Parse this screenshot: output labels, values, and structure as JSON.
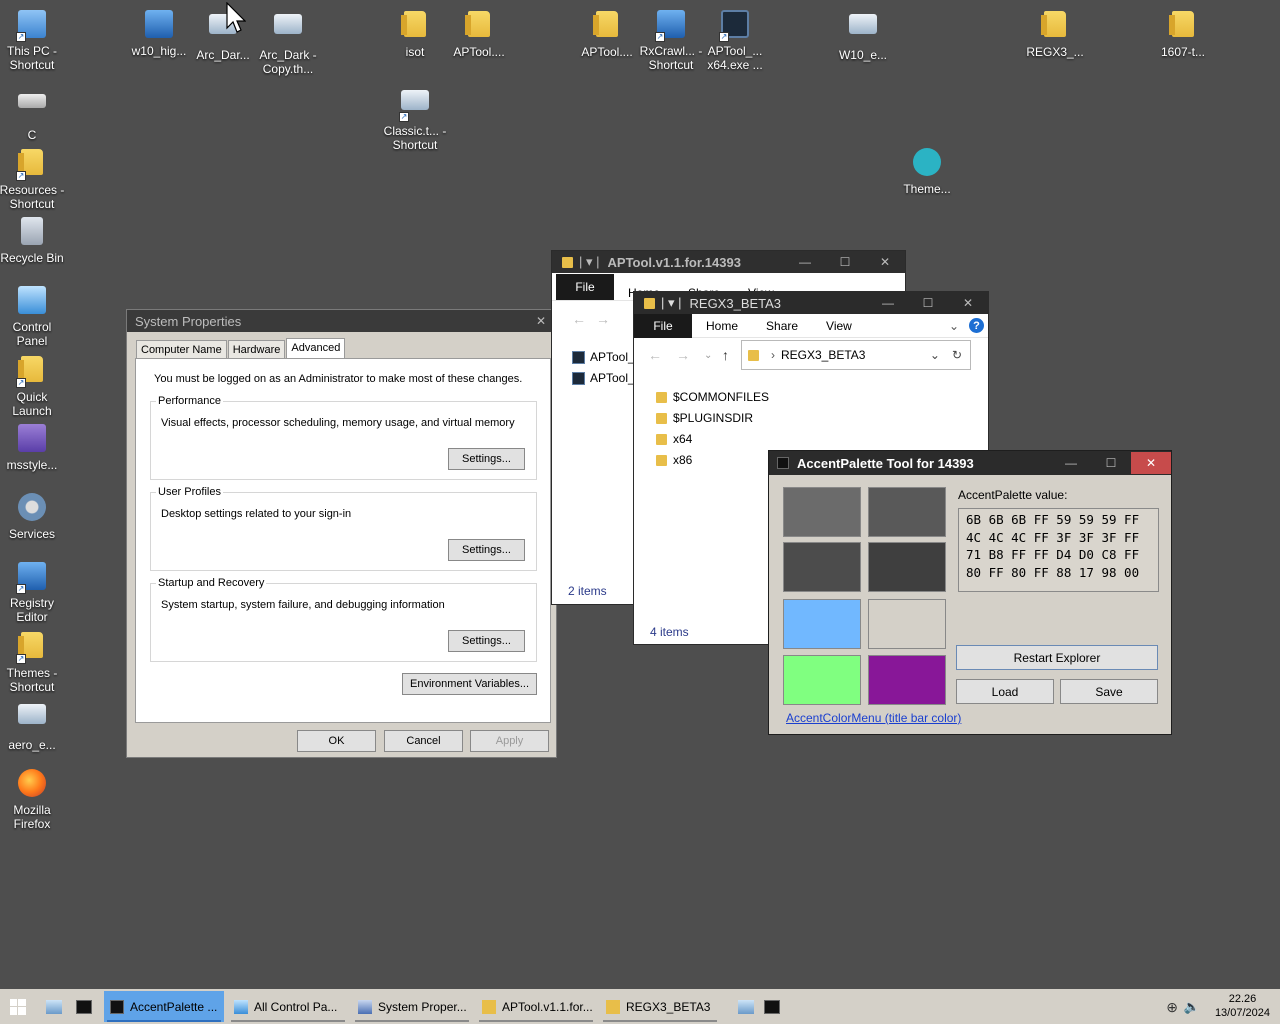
{
  "desktop": {
    "icons": [
      {
        "label": "This PC - Shortcut"
      },
      {
        "label": "C"
      },
      {
        "label": "Resources - Shortcut"
      },
      {
        "label": "Recycle Bin"
      },
      {
        "label": "Control Panel"
      },
      {
        "label": "Quick Launch"
      },
      {
        "label": "msstyle..."
      },
      {
        "label": "Services"
      },
      {
        "label": "Registry Editor"
      },
      {
        "label": "Themes - Shortcut"
      },
      {
        "label": "aero_e..."
      },
      {
        "label": "Mozilla Firefox"
      },
      {
        "label": "w10_hig..."
      },
      {
        "label": "Arc_Dar..."
      },
      {
        "label": "Arc_Dark - Copy.th..."
      },
      {
        "label": "isot"
      },
      {
        "label": "APTool...."
      },
      {
        "label": "Classic.t... - Shortcut"
      },
      {
        "label": "APTool...."
      },
      {
        "label": "RxCrawl... - Shortcut"
      },
      {
        "label": "APTool_... x64.exe ..."
      },
      {
        "label": "W10_e..."
      },
      {
        "label": "Theme..."
      },
      {
        "label": "REGX3_..."
      },
      {
        "label": "1607-t..."
      }
    ]
  },
  "sysprops": {
    "title": "System Properties",
    "tabs": [
      "Computer Name",
      "Hardware",
      "Advanced"
    ],
    "note": "You must be logged on as an Administrator to make most of these changes.",
    "groups": [
      {
        "legend": "Performance",
        "desc": "Visual effects, processor scheduling, memory usage, and virtual memory",
        "button": "Settings..."
      },
      {
        "legend": "User Profiles",
        "desc": "Desktop settings related to your sign-in",
        "button": "Settings..."
      },
      {
        "legend": "Startup and Recovery",
        "desc": "System startup, system failure, and debugging information",
        "button": "Settings..."
      }
    ],
    "env_button": "Environment Variables...",
    "ok": "OK",
    "cancel": "Cancel",
    "apply": "Apply"
  },
  "aptool_win": {
    "title": "APTool.v1.1.for.14393",
    "ribbon": [
      "File",
      "Home",
      "Share",
      "View"
    ],
    "items": [
      "APTool_",
      "APTool_"
    ],
    "status": "2 items"
  },
  "regx_win": {
    "title": "REGX3_BETA3",
    "ribbon": [
      "File",
      "Home",
      "Share",
      "View"
    ],
    "address": "REGX3_BETA3",
    "items": [
      "$COMMONFILES",
      "$PLUGINSDIR",
      "x64",
      "x86"
    ],
    "status": "4 items"
  },
  "accent": {
    "title": "AccentPalette Tool for 14393",
    "value_label": "AccentPalette value:",
    "hex_lines": [
      "6B 6B 6B FF 59 59 59 FF",
      "4C 4C 4C FF 3F 3F 3F FF",
      "71 B8 FF FF D4 D0 C8 FF",
      "80 FF 80 FF 88 17 98 00"
    ],
    "swatches": [
      "#6b6b6b",
      "#595959",
      "#4c4c4c",
      "#3f3f3f",
      "#71b8ff",
      "#d4d0c8",
      "#80ff80",
      "#881798"
    ],
    "restart": "Restart Explorer",
    "load": "Load",
    "save": "Save",
    "link": "AccentColorMenu (title bar color)"
  },
  "taskbar": {
    "items": [
      "AccentPalette ...",
      "All Control Pa...",
      "System Proper...",
      "APTool.v1.1.for...",
      "REGX3_BETA3"
    ],
    "time": "22.26",
    "date": "13/07/2024"
  }
}
